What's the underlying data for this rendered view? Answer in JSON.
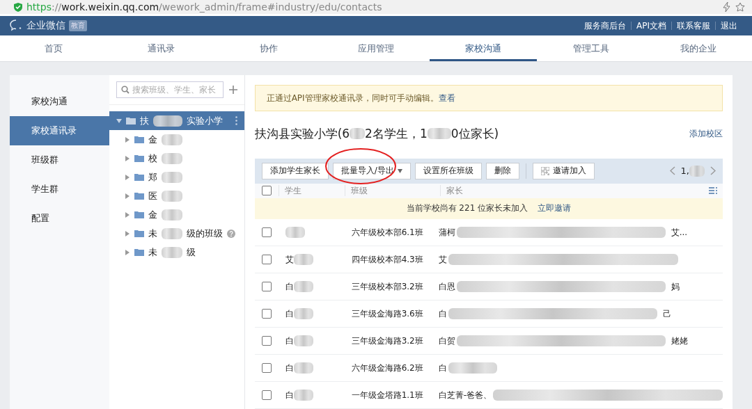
{
  "browser": {
    "url_host": "https://work.weixin.qq.com",
    "url_path": "/wework_admin/frame#industry/edu/contacts"
  },
  "header": {
    "logo": "企业微信",
    "badge": "教育",
    "links": [
      "服务商后台",
      "API文档",
      "联系客服",
      "退出"
    ]
  },
  "nav": [
    {
      "label": "首页",
      "selected": false
    },
    {
      "label": "通讯录",
      "selected": false
    },
    {
      "label": "协作",
      "selected": false
    },
    {
      "label": "应用管理",
      "selected": false
    },
    {
      "label": "家校沟通",
      "selected": true
    },
    {
      "label": "管理工具",
      "selected": false
    },
    {
      "label": "我的企业",
      "selected": false
    }
  ],
  "sidebar": [
    {
      "label": "家校沟通",
      "selected": false
    },
    {
      "label": "家校通讯录",
      "selected": true
    },
    {
      "label": "班级群",
      "selected": false
    },
    {
      "label": "学生群",
      "selected": false
    },
    {
      "label": "配置",
      "selected": false
    }
  ],
  "tree": {
    "search_placeholder": "搜索班级、学生、家长",
    "root": {
      "parts": [
        "扶",
        "实验小学"
      ],
      "selected": true,
      "expanded": true,
      "children": [
        {
          "parts": [
            "金"
          ],
          "help": false
        },
        {
          "parts": [
            "校"
          ],
          "help": false
        },
        {
          "parts": [
            "郑"
          ],
          "help": false
        },
        {
          "parts": [
            "医"
          ],
          "help": false
        },
        {
          "parts": [
            "金"
          ],
          "help": false
        },
        {
          "parts": [
            "未",
            "级的班级"
          ],
          "help": true
        },
        {
          "parts": [
            "未",
            "级"
          ],
          "help": false
        }
      ]
    }
  },
  "notice": {
    "text": "正通过API管理家校通讯录，同时可手动编辑。",
    "link": "查看"
  },
  "school_title": [
    "扶沟县实验小学(6",
    "2名学生，1",
    "0位家长)"
  ],
  "add_campus": "添加校区",
  "toolbar": [
    {
      "label": "添加学生家长",
      "kind": "plain"
    },
    {
      "label": "批量导入/导出",
      "kind": "dropdown"
    },
    {
      "label": "设置所在班级",
      "kind": "plain"
    },
    {
      "label": "删除",
      "kind": "plain"
    },
    {
      "label": "邀请加入",
      "kind": "qr"
    }
  ],
  "pager": "1,",
  "select_all_checked": false,
  "columns": [
    "学生",
    "班级",
    "家长"
  ],
  "invite_banner": {
    "text": "当前学校尚有 221 位家长未加入",
    "link": "立即邀请"
  },
  "rows": [
    {
      "class": "六年级校本部6.1班",
      "parent_head": "蒲柯",
      "parent_tail": "艾...",
      "checked": false
    },
    {
      "student": "艾",
      "class": "四年级校本部4.3班",
      "parent_head": "艾",
      "checked": false
    },
    {
      "student": "白",
      "class": "三年级校本部3.2班",
      "parent_head": "白恩",
      "parent_tail": "妈",
      "checked": false
    },
    {
      "student": "白",
      "class": "三年级金海路3.6班",
      "parent_head": "白",
      "parent_tail": "己",
      "checked": false
    },
    {
      "student": "白",
      "class": "三年级金海路3.2班",
      "parent_head": "白贺",
      "parent_tail": "姥姥",
      "checked": false
    },
    {
      "student": "白",
      "class": "六年级金海路6.2班",
      "parent_head": "白",
      "checked": false
    },
    {
      "student": "白",
      "class": "一年级金塔路1.1班",
      "parent_head": "白芝菁-爸爸、",
      "checked": false
    }
  ],
  "annotation": {
    "kind": "ellipse"
  }
}
